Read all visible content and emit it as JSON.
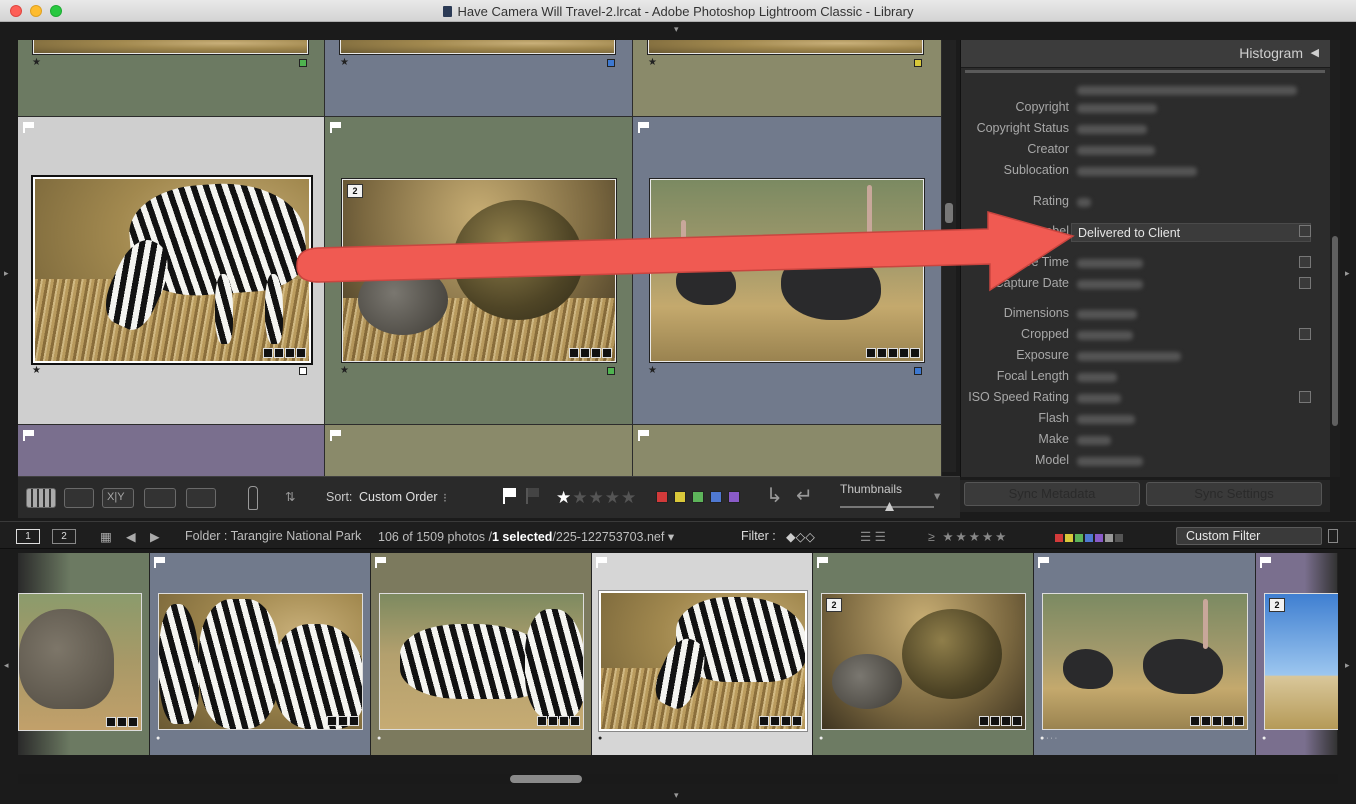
{
  "window": {
    "title": "Have Camera Will Travel-2.lrcat - Adobe Photoshop Lightroom Classic - Library"
  },
  "toolbar": {
    "sort_label": "Sort:",
    "sort_value": "Custom Order",
    "thumbnails_label": "Thumbnails",
    "view_buttons": [
      "grid-view",
      "loupe-view",
      "compare-view",
      "survey-view",
      "people-view"
    ],
    "color_labels": [
      "#d23a3a",
      "#d9c83a",
      "#5db45a",
      "#4f79d2",
      "#8a5bc8"
    ]
  },
  "right_panel": {
    "histogram_title": "Histogram",
    "metadata": [
      {
        "label": "Copyright",
        "value": ""
      },
      {
        "label": "Copyright Status",
        "value": ""
      },
      {
        "label": "Creator",
        "value": ""
      },
      {
        "label": "Sublocation",
        "value": ""
      },
      {
        "label": "Rating",
        "value": ""
      },
      {
        "label": "Label",
        "value": "Delivered to Client"
      },
      {
        "label": "Capture Time",
        "value": ""
      },
      {
        "label": "Capture Date",
        "value": ""
      },
      {
        "label": "Dimensions",
        "value": ""
      },
      {
        "label": "Cropped",
        "value": ""
      },
      {
        "label": "Exposure",
        "value": ""
      },
      {
        "label": "Focal Length",
        "value": ""
      },
      {
        "label": "ISO Speed Rating",
        "value": ""
      },
      {
        "label": "Flash",
        "value": ""
      },
      {
        "label": "Make",
        "value": ""
      },
      {
        "label": "Model",
        "value": ""
      }
    ],
    "sync_metadata": "Sync Metadata",
    "sync_settings": "Sync Settings"
  },
  "filmstrip_bar": {
    "monitor_1": "1",
    "monitor_2": "2",
    "folder": "Folder : Tarangire National Park",
    "count_prefix": "106 of 1509 photos /",
    "selected": "1 selected",
    "filename": "/225-122753703.nef",
    "filter_label": "Filter :",
    "custom_filter": "Custom Filter"
  },
  "grid": {
    "stack_badge": "2"
  }
}
